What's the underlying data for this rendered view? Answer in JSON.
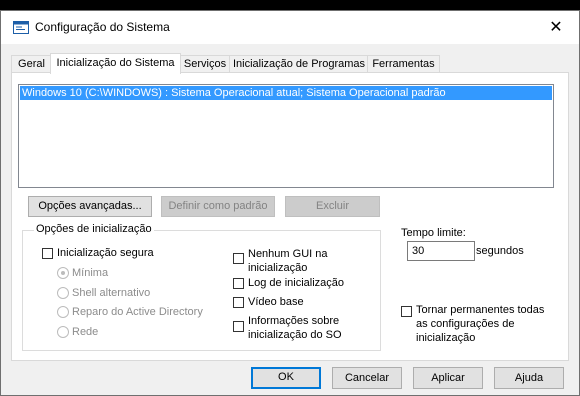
{
  "window": {
    "title": "Configuração do Sistema"
  },
  "tabs": [
    {
      "label": "Geral"
    },
    {
      "label": "Inicialização do Sistema"
    },
    {
      "label": "Serviços"
    },
    {
      "label": "Inicialização de Programas"
    },
    {
      "label": "Ferramentas"
    }
  ],
  "os_list": {
    "selected_entry": "Windows 10 (C:\\WINDOWS) : Sistema Operacional atual; Sistema Operacional padrão"
  },
  "list_buttons": {
    "advanced": "Opções avançadas...",
    "set_default": "Definir como padrão",
    "delete": "Excluir"
  },
  "boot_options": {
    "group_label": "Opções de inicialização",
    "safe_boot": "Inicialização segura",
    "radios": [
      "Mínima",
      "Shell alternativo",
      "Reparo do Active Directory",
      "Rede"
    ],
    "no_gui_1": "Nenhum GUI na",
    "no_gui_2": "inicialização",
    "boot_log": "Log de inicialização",
    "base_video": "Vídeo base",
    "os_info_1": "Informações sobre",
    "os_info_2": "inicialização do SO"
  },
  "timeout": {
    "label": "Tempo limite:",
    "value": "30",
    "unit": "segundos"
  },
  "permanent": {
    "line1": "Tornar permanentes todas",
    "line2": "as configurações de",
    "line3": "inicialização"
  },
  "dialog_buttons": {
    "ok": "OK",
    "cancel": "Cancelar",
    "apply": "Aplicar",
    "help": "Ajuda"
  },
  "colors": {
    "selection": "#3399ff",
    "focus_border": "#0078d7"
  }
}
